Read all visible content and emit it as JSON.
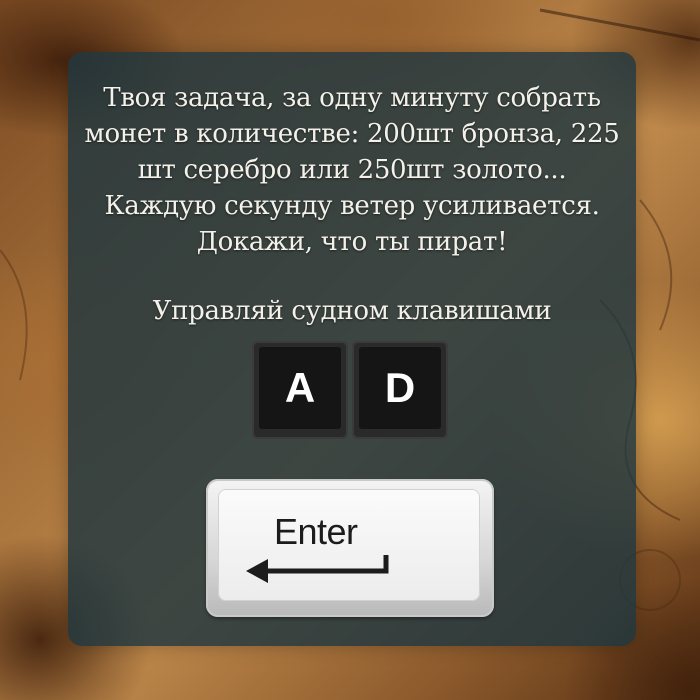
{
  "mission": {
    "lines": [
      "Твоя задача, за одну минуту собрать",
      "монет в количестве: 200шт бронза, 225",
      "шт серебро или 250шт золото...",
      "Каждую секунду ветер усиливается.",
      "Докажи, что ты пират!"
    ]
  },
  "controls": {
    "label": "Управляй судном клавишами",
    "left_key": "A",
    "right_key": "D"
  },
  "start": {
    "key_label": "Enter",
    "icon": "enter-arrow-icon"
  },
  "colors": {
    "panel": "#203740",
    "text": "#f4f1ea",
    "key_dark": "#151515",
    "key_light": "#ececec"
  }
}
